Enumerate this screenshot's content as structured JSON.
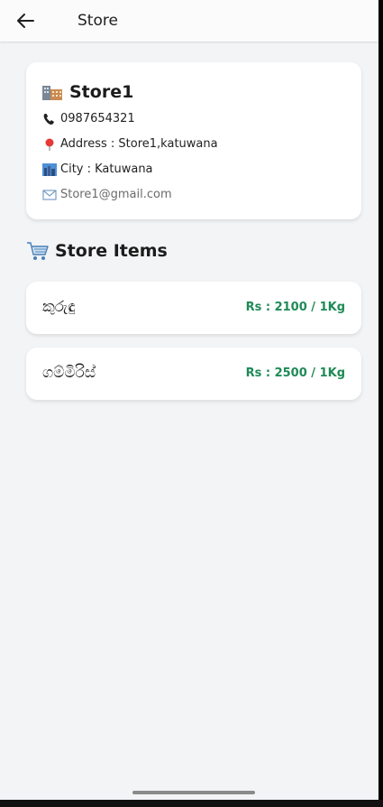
{
  "header": {
    "title": "Store",
    "back_icon": "arrow-left-icon"
  },
  "store": {
    "name": "Store1",
    "phone": "0987654321",
    "address": "Address : Store1,katuwana",
    "city": "City : Katuwana",
    "email": "Store1@gmail.com",
    "icons": {
      "store": "office-building-icon",
      "phone": "telephone-icon",
      "address": "location-pin-icon",
      "city": "cityscape-icon",
      "email": "envelope-icon"
    }
  },
  "items_section": {
    "title": "Store Items",
    "icon": "shopping-cart-icon"
  },
  "items": [
    {
      "name": "කුරුඳු",
      "price": "Rs : 2100 / 1Kg"
    },
    {
      "name": "ගම්මිරිස්",
      "price": "Rs : 2500 / 1Kg"
    }
  ],
  "colors": {
    "background": "#f3f4f6",
    "card": "#ffffff",
    "price_green": "#1f8a57",
    "text": "#1c1c1c",
    "email_gray": "#6b6b6b"
  }
}
